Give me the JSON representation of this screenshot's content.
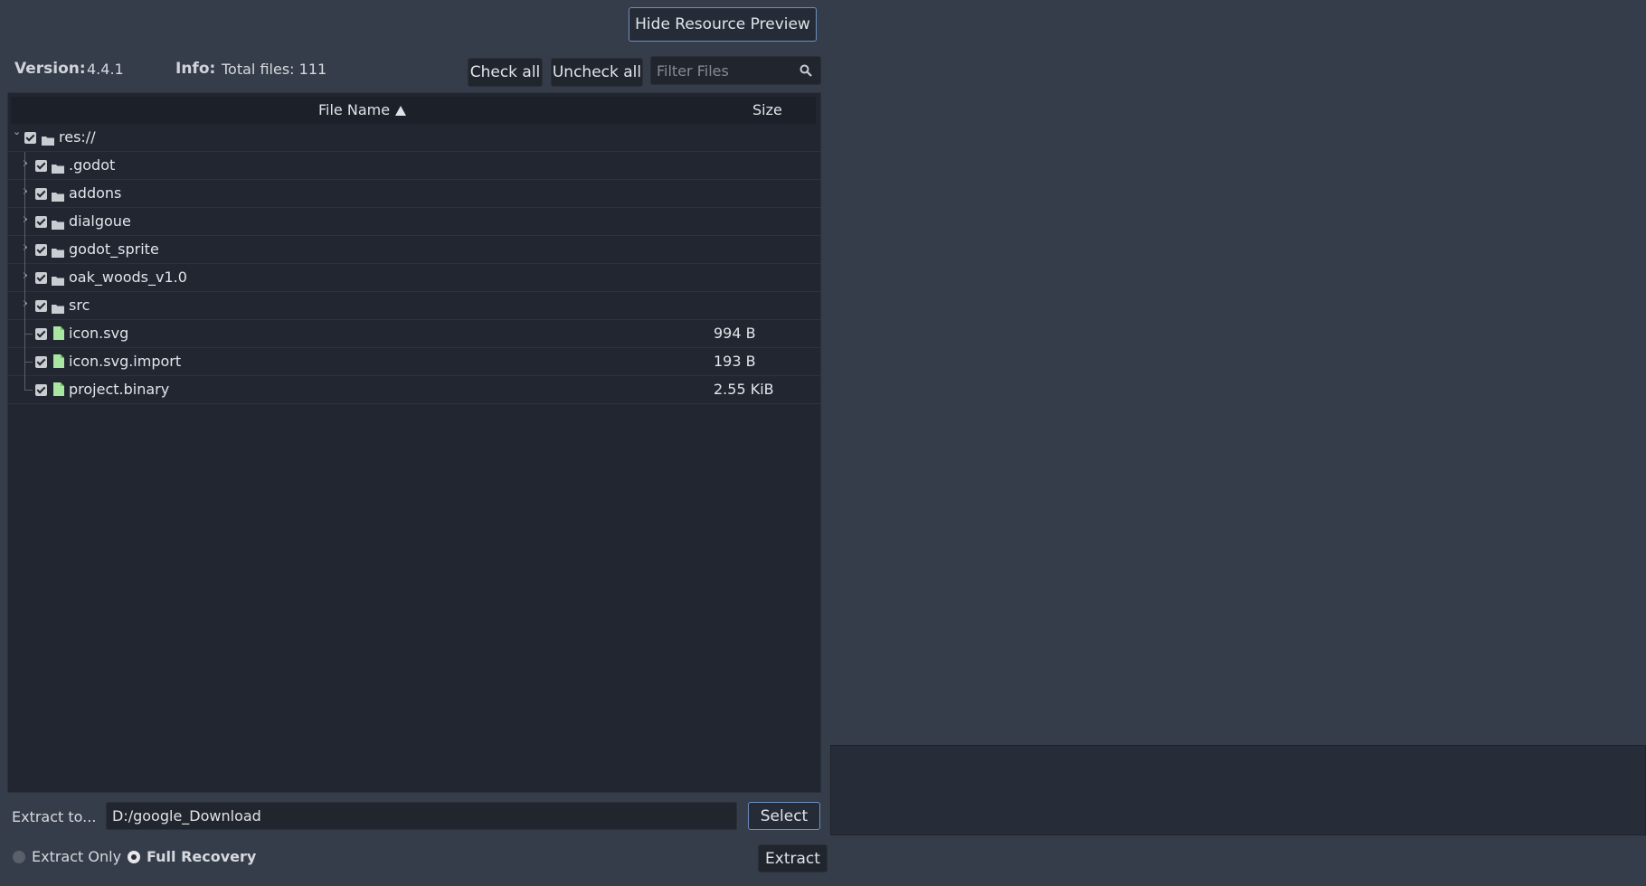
{
  "toolbar": {
    "hide_preview_label": "Hide Resource Preview",
    "version_label": "Version:",
    "version_value": "4.4.1",
    "info_label": "Info:",
    "info_value": "Total files: 111",
    "check_all_label": "Check all",
    "uncheck_all_label": "Uncheck all",
    "filter_placeholder": "Filter Files",
    "filter_value": ""
  },
  "tree": {
    "columns": {
      "name": "File Name",
      "size": "Size"
    },
    "root": {
      "label": "res://",
      "checked": true,
      "expanded": true
    },
    "items": [
      {
        "label": ".godot",
        "type": "folder",
        "checked": true,
        "size": ""
      },
      {
        "label": "addons",
        "type": "folder",
        "checked": true,
        "size": ""
      },
      {
        "label": "dialgoue",
        "type": "folder",
        "checked": true,
        "size": ""
      },
      {
        "label": "godot_sprite",
        "type": "folder",
        "checked": true,
        "size": ""
      },
      {
        "label": "oak_woods_v1.0",
        "type": "folder",
        "checked": true,
        "size": ""
      },
      {
        "label": "src",
        "type": "folder",
        "checked": true,
        "size": ""
      },
      {
        "label": "icon.svg",
        "type": "file",
        "checked": true,
        "size": "994 B"
      },
      {
        "label": "icon.svg.import",
        "type": "file",
        "checked": true,
        "size": "193 B"
      },
      {
        "label": "project.binary",
        "type": "file",
        "checked": true,
        "size": "2.55 KiB"
      }
    ]
  },
  "extract": {
    "label": "Extract to...",
    "path": "D:/google_Download",
    "select_label": "Select",
    "extract_label": "Extract",
    "mode_extract_only": "Extract Only",
    "mode_full_recovery": "Full Recovery",
    "selected_mode": "Full Recovery"
  },
  "colors": {
    "background": "#363d4a",
    "panel": "#212630",
    "folder_icon": "#c9ccd1",
    "file_icon": "#a8e6a1",
    "accent_border": "#6b8fbf"
  }
}
